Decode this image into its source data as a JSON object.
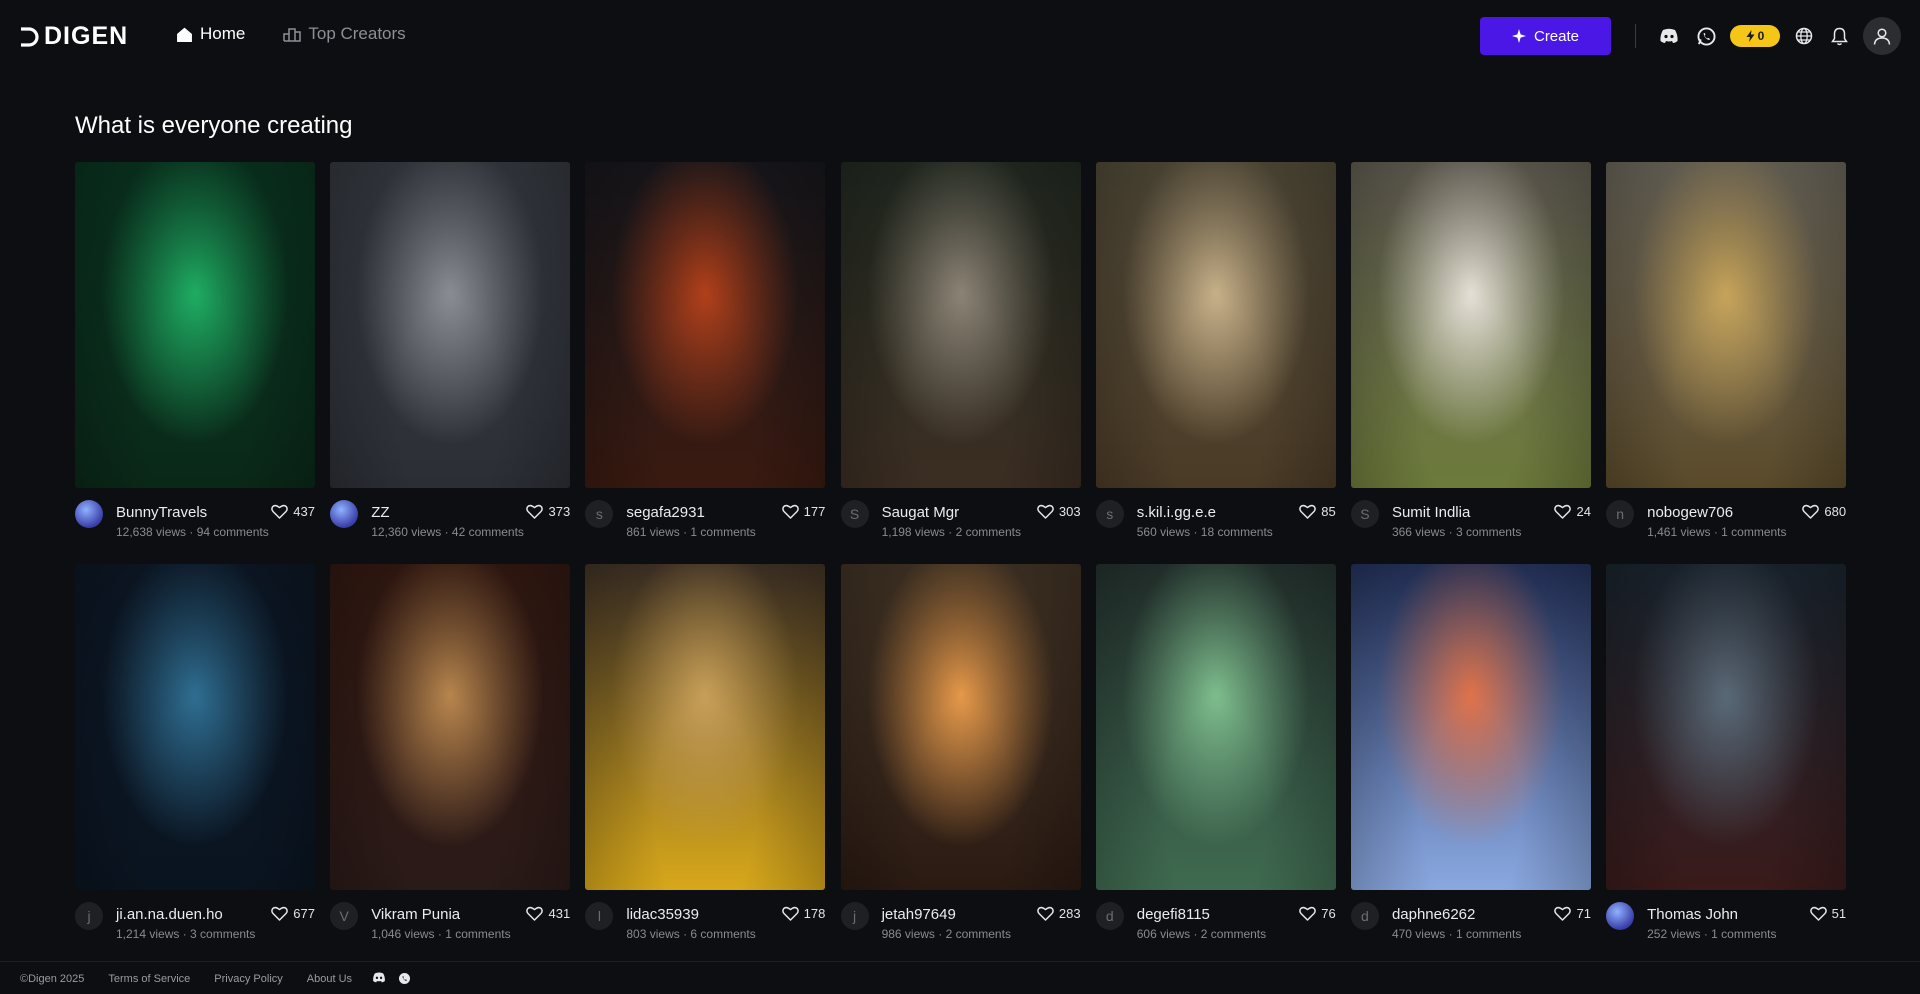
{
  "brand": {
    "name": "DIGEN"
  },
  "nav": {
    "items": [
      {
        "label": "Home",
        "icon": "home-icon",
        "active": true
      },
      {
        "label": "Top Creators",
        "icon": "leaderboard-icon",
        "active": false
      }
    ]
  },
  "header": {
    "create_label": "Create",
    "credits": "0",
    "accent_color": "#4a17e6",
    "credits_color": "#f5c518"
  },
  "main": {
    "title": "What is everyone creating",
    "cards": [
      {
        "user": "BunnyTravels",
        "initial": "",
        "avatar_pic": true,
        "likes": "437",
        "stats": "12,638 views · 94 comments",
        "colors": [
          "#0b3a24",
          "#1fae63",
          "#0a2818"
        ]
      },
      {
        "user": "ZZ",
        "initial": "",
        "avatar_pic": true,
        "likes": "373",
        "stats": "12,360 views · 42 comments",
        "colors": [
          "#3c4048",
          "#8b8e94",
          "#2b2e35"
        ]
      },
      {
        "user": "segafa2931",
        "initial": "s",
        "avatar_pic": false,
        "likes": "177",
        "stats": "861 views · 1 comments",
        "colors": [
          "#1b1a20",
          "#b3401a",
          "#3a1a10"
        ]
      },
      {
        "user": "Saugat Mgr",
        "initial": "S",
        "avatar_pic": false,
        "likes": "303",
        "stats": "1,198 views · 2 comments",
        "colors": [
          "#273026",
          "#8d8476",
          "#3b2d22"
        ]
      },
      {
        "user": "s.kil.i.gg.e.e",
        "initial": "s",
        "avatar_pic": false,
        "likes": "85",
        "stats": "560 views · 18 comments",
        "colors": [
          "#5c5440",
          "#c9b28a",
          "#4a3a26"
        ]
      },
      {
        "user": "Sumit Indlia",
        "initial": "S",
        "avatar_pic": false,
        "likes": "24",
        "stats": "366 views · 3 comments",
        "colors": [
          "#6f6a5e",
          "#e6e2d8",
          "#6c7a3a"
        ]
      },
      {
        "user": "nobogew706",
        "initial": "n",
        "avatar_pic": false,
        "likes": "680",
        "stats": "1,461 views · 1 comments",
        "colors": [
          "#7a7466",
          "#c8a55a",
          "#5a4a2a"
        ]
      },
      {
        "user": "ji.an.na.duen.ho",
        "initial": "j",
        "avatar_pic": false,
        "likes": "677",
        "stats": "1,214 views · 3 comments",
        "colors": [
          "#0e1a2a",
          "#2f6f93",
          "#0a1420"
        ]
      },
      {
        "user": "Vikram Punia",
        "initial": "V",
        "avatar_pic": false,
        "likes": "431",
        "stats": "1,046 views · 1 comments",
        "colors": [
          "#3a1c14",
          "#b9874e",
          "#2a1a18"
        ]
      },
      {
        "user": "lidac35939",
        "initial": "l",
        "avatar_pic": false,
        "likes": "178",
        "stats": "803 views · 6 comments",
        "colors": [
          "#4a3a2c",
          "#c9a05a",
          "#d8a81a"
        ]
      },
      {
        "user": "jetah97649",
        "initial": "j",
        "avatar_pic": false,
        "likes": "283",
        "stats": "986 views · 2 comments",
        "colors": [
          "#4a3a2a",
          "#e89a4a",
          "#2a1a12"
        ]
      },
      {
        "user": "degefi8115",
        "initial": "d",
        "avatar_pic": false,
        "likes": "76",
        "stats": "606 views · 2 comments",
        "colors": [
          "#2a3a36",
          "#7fbf8e",
          "#3f6a50"
        ]
      },
      {
        "user": "daphne6262",
        "initial": "d",
        "avatar_pic": false,
        "likes": "71",
        "stats": "470 views · 1 comments",
        "colors": [
          "#2a3a6a",
          "#e2734a",
          "#8aa8e0"
        ]
      },
      {
        "user": "Thomas John",
        "initial": "",
        "avatar_pic": true,
        "likes": "51",
        "stats": "252 views · 1 comments",
        "colors": [
          "#1e2a36",
          "#5a6a78",
          "#3a1a1a"
        ]
      }
    ]
  },
  "footer": {
    "copyright": "©Digen 2025",
    "links": [
      "Terms of Service",
      "Privacy Policy",
      "About Us"
    ]
  }
}
